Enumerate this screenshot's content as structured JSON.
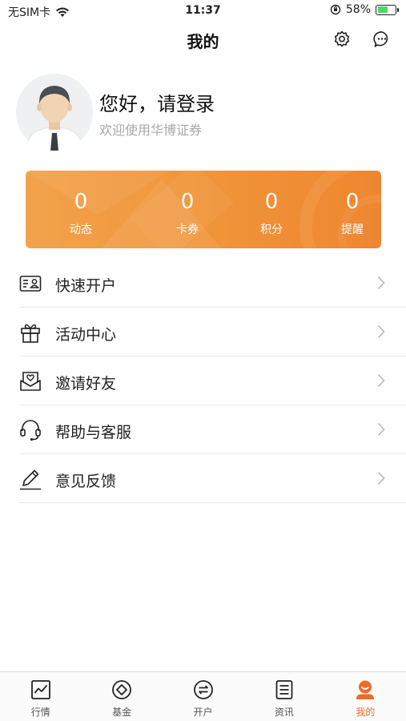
{
  "status_bar": {
    "carrier": "无SIM卡",
    "time": "11:37",
    "battery": "58%",
    "battery_level": 0.58
  },
  "nav": {
    "title": "我的",
    "settings_icon": "gear-icon",
    "message_icon": "chat-bubble-icon"
  },
  "profile": {
    "greeting": "您好，请登录",
    "welcome": "欢迎使用华博证券"
  },
  "stats": [
    {
      "value": "0",
      "label": "动态"
    },
    {
      "value": "0",
      "label": "卡券"
    },
    {
      "value": "0",
      "label": "积分"
    },
    {
      "value": "0",
      "label": "提醒"
    }
  ],
  "menu": [
    {
      "label": "快速开户",
      "icon": "id-card-icon"
    },
    {
      "label": "活动中心",
      "icon": "gift-icon"
    },
    {
      "label": "邀请好友",
      "icon": "envelope-heart-icon"
    },
    {
      "label": "帮助与客服",
      "icon": "headset-icon"
    },
    {
      "label": "意见反馈",
      "icon": "pencil-icon"
    }
  ],
  "tabs": [
    {
      "label": "行情",
      "icon": "chart-icon"
    },
    {
      "label": "基金",
      "icon": "fund-diamond-icon"
    },
    {
      "label": "开户",
      "icon": "exchange-icon"
    },
    {
      "label": "资讯",
      "icon": "document-icon"
    },
    {
      "label": "我的",
      "icon": "user-icon",
      "active": true
    }
  ],
  "colors": {
    "accent": "#ee6b24",
    "card_start": "#f2a34c",
    "card_end": "#ee8630"
  }
}
